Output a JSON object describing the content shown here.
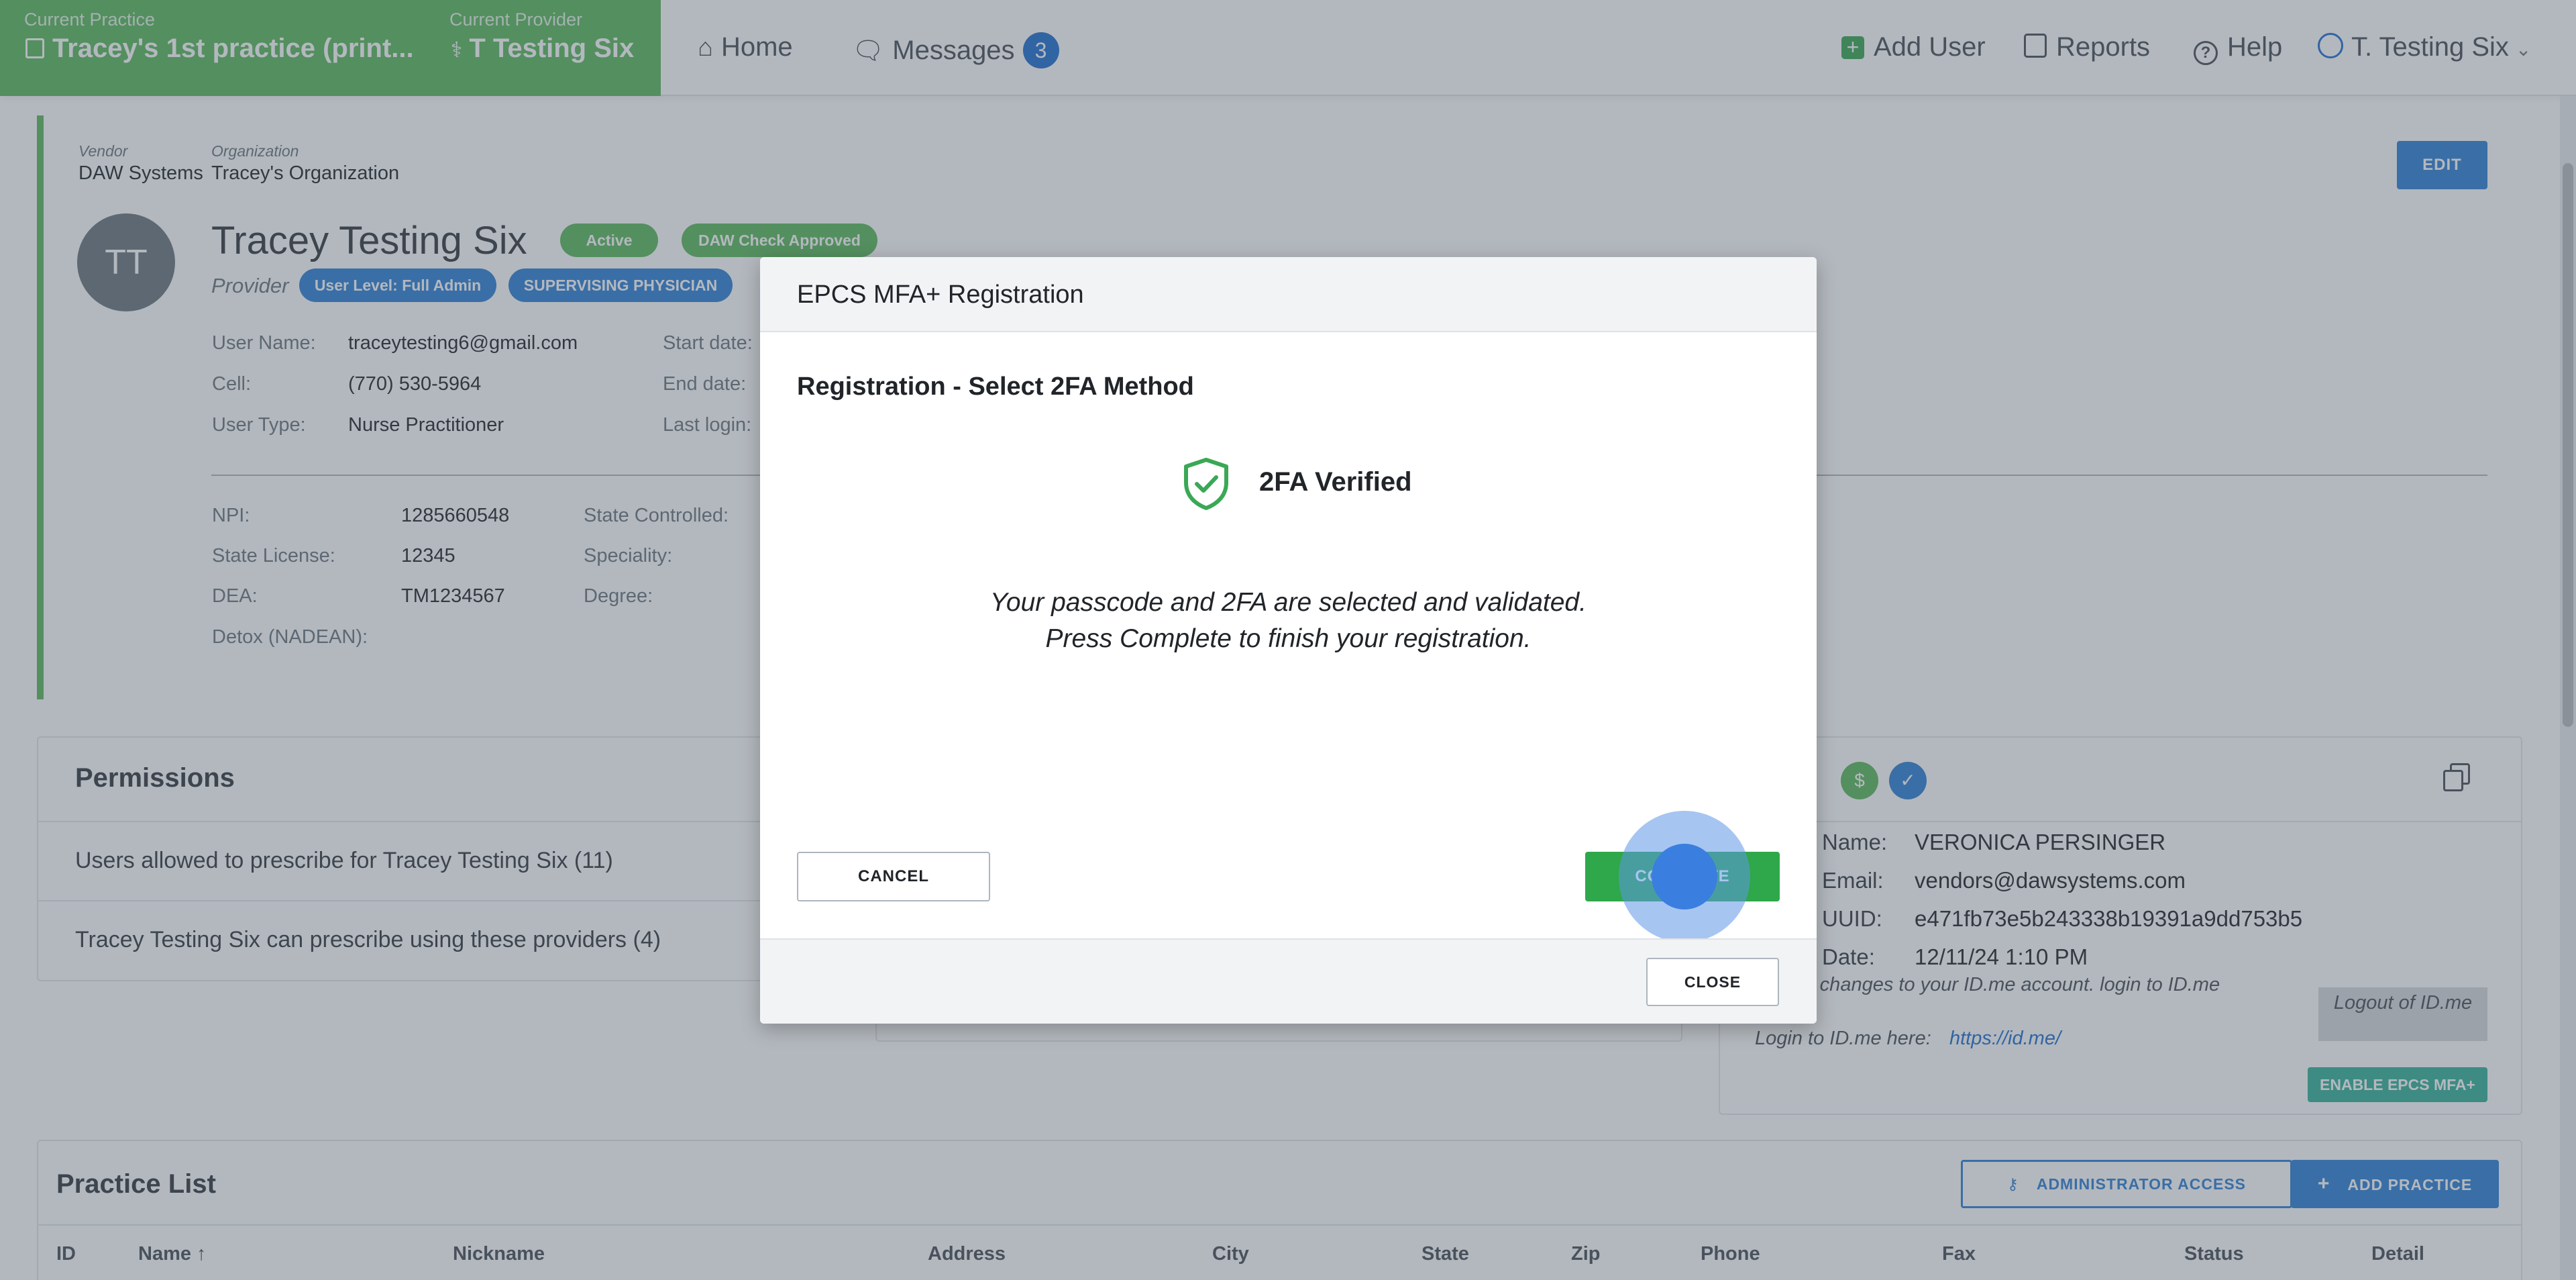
{
  "nav": {
    "practice_label": "Current Practice",
    "practice_value": "Tracey's 1st practice (print...",
    "provider_label": "Current Provider",
    "provider_value": "T Testing Six",
    "home": "Home",
    "messages": "Messages",
    "messages_count": "3",
    "add_user": "Add User",
    "reports": "Reports",
    "help": "Help",
    "user": "T. Testing Six"
  },
  "profile": {
    "vendor_label": "Vendor",
    "vendor_value": "DAW Systems",
    "org_label": "Organization",
    "org_value": "Tracey's Organization",
    "edit": "EDIT",
    "initials": "TT",
    "name": "Tracey Testing Six",
    "status": "Active",
    "daw_check": "DAW Check Approved",
    "role": "Provider",
    "user_level": "User Level: Full Admin",
    "supervising": "SUPERVISING PHYSICIAN",
    "user_name_label": "User Name:",
    "user_name": "traceytesting6@gmail.com",
    "cell_label": "Cell:",
    "cell": "(770) 530-5964",
    "user_type_label": "User Type:",
    "user_type": "Nurse Practitioner",
    "start_label": "Start date:",
    "end_label": "End date:",
    "last_login_label": "Last login:",
    "npi_label": "NPI:",
    "npi": "1285660548",
    "state_license_label": "State License:",
    "state_license": "12345",
    "dea_label": "DEA:",
    "dea": "TM1234567",
    "detox_label": "Detox (NADEAN):",
    "state_controlled_label": "State Controlled:",
    "speciality_label": "Speciality:",
    "degree_label": "Degree:"
  },
  "permissions": {
    "title": "Permissions",
    "rows": [
      "Users allowed to prescribe for Tracey Testing Six (11)",
      "Tracey Testing Six can prescribe using these providers (4)"
    ]
  },
  "idme": {
    "title_fragment": "n",
    "name_label": "Name:",
    "name": "VERONICA PERSINGER",
    "email_label": "Email:",
    "email": "vendors@dawsystems.com",
    "uuid_label": "UUID:",
    "uuid": "e471fb73e5b243338b19391a9dd753b5",
    "date_label": "Date:",
    "date": "12/11/24 1:10 PM",
    "changes_note": "ke changes to your ID.me account. login to ID.me",
    "login_here": "Login to ID.me here:",
    "link": "https://id.me/",
    "logout": "Logout of ID.me",
    "enable": "ENABLE EPCS MFA+"
  },
  "practice": {
    "title": "Practice List",
    "admin_access": "ADMINISTRATOR ACCESS",
    "add_practice": "ADD PRACTICE",
    "columns": [
      "ID",
      "Name ↑",
      "Nickname",
      "Address",
      "City",
      "State",
      "Zip",
      "Phone",
      "Fax",
      "Status",
      "Detail"
    ]
  },
  "modal": {
    "title": "EPCS MFA+ Registration",
    "subtitle": "Registration - Select 2FA Method",
    "verified": "2FA Verified",
    "line1": "Your passcode and 2FA are selected and validated.",
    "line2": "Press Complete to finish your registration.",
    "cancel": "CANCEL",
    "complete": "COMPLETE",
    "close": "CLOSE"
  },
  "colors": {
    "brand_green": "#5cb85c",
    "primary_blue": "#2f80d6",
    "complete_green": "#2ea84a",
    "teal": "#35b29a"
  }
}
